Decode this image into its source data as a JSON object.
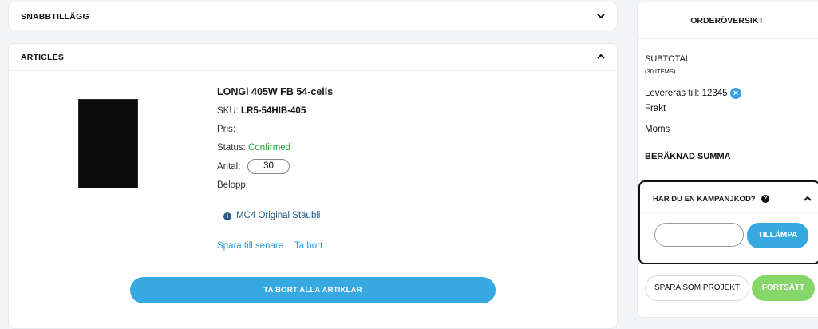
{
  "accordions": {
    "quick_add": {
      "title": "SNABBTILLÄGG"
    },
    "articles": {
      "title": "ARTICLES"
    }
  },
  "product": {
    "name": "LONGi 405W FB 54-cells",
    "sku_label": "SKU:",
    "sku_value": "LR5-54HIB-405",
    "price_label": "Pris:",
    "status_label": "Status:",
    "status_value": "Confirmed",
    "qty_label": "Antal:",
    "qty_value": "30",
    "amount_label": "Belopp:",
    "addon_label": "MC4 Original Stäubli",
    "save_later": "Spara till senare",
    "remove": "Ta bort"
  },
  "actions": {
    "remove_all": "TA BORT ALLA ARTIKLAR"
  },
  "summary": {
    "title": "ORDERÖVERSIKT",
    "subtotal_label": "SUBTOTAL",
    "items_count": "(30 ITEMS)",
    "deliver_to": "Levereras till: 12345",
    "shipping": "Frakt",
    "tax": "Moms",
    "total": "BERÄKNAD SUMMA",
    "campaign_title": "HAR DU EN KAMPANJKOD?",
    "apply": "TILLÄMPA",
    "save_project": "SPARA SOM PROJEKT",
    "continue": "FORTSÄTT"
  },
  "icons": {
    "chevron_down": "chevron-down-icon",
    "chevron_up": "chevron-up-icon",
    "info": "info-icon",
    "remove_location": "x-circle-icon",
    "help": "help-icon"
  },
  "colors": {
    "accent": "#36a9e1",
    "success": "#1f9a3a",
    "continue": "#86d66a",
    "link": "#2b9bd8"
  }
}
